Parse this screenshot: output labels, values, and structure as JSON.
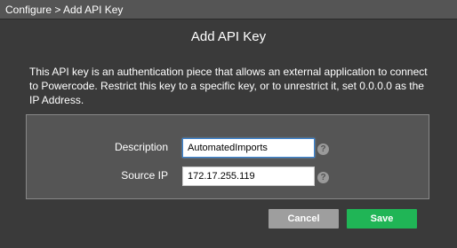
{
  "breadcrumb": "Configure > Add API Key",
  "dialog": {
    "title": "Add API Key",
    "description": "This API key is an authentication piece that allows an external application to connect to Powercode. Restrict this key to a specific key, or to unrestrict it, set 0.0.0.0 as the IP Address."
  },
  "form": {
    "description_label": "Description",
    "description_value": "AutomatedImports",
    "source_ip_label": "Source IP",
    "source_ip_value": "172.17.255.119",
    "help_glyph": "?"
  },
  "buttons": {
    "cancel": "Cancel",
    "save": "Save"
  },
  "colors": {
    "background": "#3a3a3a",
    "panel": "#555555",
    "save": "#20b556",
    "cancel": "#9e9e9e"
  },
  "icons": {
    "help": "question-circle-icon"
  }
}
